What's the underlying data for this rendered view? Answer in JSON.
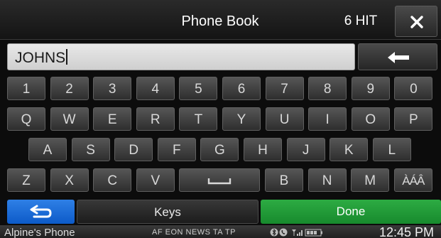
{
  "header": {
    "title": "Phone Book",
    "hits": "6 HIT",
    "close_icon": "close-icon"
  },
  "search": {
    "value": "JOHNS",
    "backspace_icon": "left-arrow-icon"
  },
  "keyboard": {
    "row1": [
      "1",
      "2",
      "3",
      "4",
      "5",
      "6",
      "7",
      "8",
      "9",
      "0"
    ],
    "row2": [
      "Q",
      "W",
      "E",
      "R",
      "T",
      "Y",
      "U",
      "I",
      "O",
      "P"
    ],
    "row3": [
      "A",
      "S",
      "D",
      "F",
      "G",
      "H",
      "J",
      "K",
      "L"
    ],
    "row4": [
      "Z",
      "X",
      "C",
      "V",
      "␣",
      "B",
      "N",
      "M",
      "ÀÁÂ"
    ],
    "space_icon": "space-bar-icon"
  },
  "actions": {
    "back_icon": "return-arrow-icon",
    "keys_label": "Keys",
    "done_label": "Done"
  },
  "status": {
    "device": "Alpine's Phone",
    "rds": "AF EON NEWS TA TP",
    "icons": [
      "bluetooth-icon",
      "phone-icon",
      "signal-icon",
      "battery-icon"
    ],
    "time": "12:45 PM"
  },
  "colors": {
    "back_button": "#1a6fd8",
    "done_button": "#22a33a",
    "key_face": "#3e3e3e",
    "input_field": "#dcdcdc"
  }
}
